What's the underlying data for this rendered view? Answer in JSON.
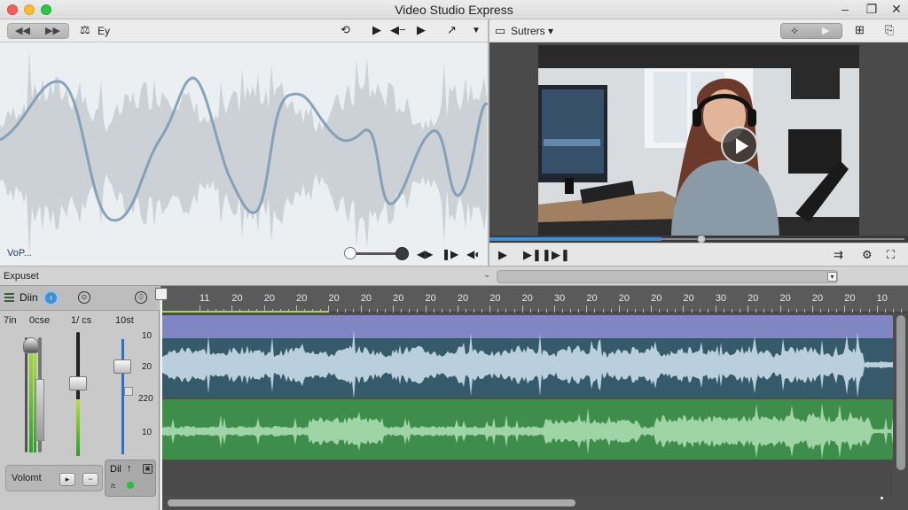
{
  "window": {
    "title": "Video Studio Express"
  },
  "toolbar_left": {
    "back_label": "◀◀",
    "forward_label": "▶▶",
    "view_label": "Ey"
  },
  "wave_viewer": {
    "label": "VoP..."
  },
  "toolbar_right": {
    "preview_menu": "Sutrers ▾"
  },
  "preview": {
    "progress": 0.41
  },
  "export_bar": {
    "label": "Expuset"
  },
  "mixer": {
    "title": "Diin",
    "info": "ı",
    "channels": [
      {
        "label": "7in",
        "value": 0.95
      },
      {
        "label": "0cse",
        "value": 0.6
      },
      {
        "label": "1/ cs",
        "value": 0.6
      },
      {
        "label": "10st",
        "value": 0.75
      }
    ],
    "scale": [
      "10",
      "20",
      "220",
      "10"
    ],
    "volume_label": "Volomt",
    "box_label": "Dil",
    "box_small": "/c"
  },
  "timeline": {
    "ruler_labels": [
      "11",
      "20",
      "20",
      "20",
      "20",
      "20",
      "20",
      "20",
      "20",
      "20",
      "20",
      "30",
      "20",
      "20",
      "20",
      "20",
      "30",
      "20",
      "20",
      "20",
      "20",
      "10"
    ]
  },
  "colors": {
    "accent": "#3d8fd6",
    "audio_track": "#355a6a",
    "audio_track_top": "#7f86c2",
    "music_track": "#3f8d4a"
  }
}
